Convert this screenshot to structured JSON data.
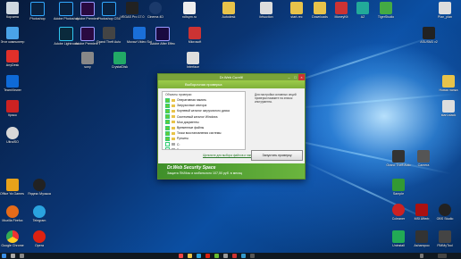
{
  "window": {
    "title": "Dr.Web CureIt!",
    "header": "Выборочная проверка",
    "tree_header": "Объекты проверки",
    "tree_items": [
      "Оперативная память",
      "Загрузочные сектора",
      "Корневой каталог загрузочного диска",
      "Системный каталог Windows",
      "Мои документы",
      "Временные файлы",
      "Точки восстановления системы",
      "Руткиты",
      "C:",
      "D:"
    ],
    "info_text": "Для настройки основных опций проверки нажмите на значок инструмента.",
    "scan_button": "Запустить проверку",
    "link_text": "Щелкните для выбора файлов и папок",
    "banner_title": "Dr.Web Security Space",
    "banner_sub": "Защита ПК/Мас и мобильного 107,50 руб. в месяц"
  },
  "desktop_icons": {
    "left": [
      "Корзина",
      "Этот компьютер",
      "AnyDesk",
      "TeamViewer",
      "Кряко",
      "UltraISO",
      "Office Ya Games 2013",
      "Яндекс Музыка",
      "Mozilla Firefox",
      "Telegram",
      "Google Chrome",
      "Opera"
    ],
    "top_row": [
      "Photoshop",
      "Adobe Photoshop",
      "Adobe Premiere",
      "Photoshop CS6",
      "VEGAS Pro 17.0",
      "Cinema 4D",
      "rollspm.ru",
      "Autodesk",
      "ibfsuction",
      "start-rec",
      "Downloads",
      "MoneyKit",
      "AZ",
      "TigerStudio",
      "Plan_plan"
    ],
    "middle": [
      "Adobe Lightroom",
      "Adobe Premiere Pro",
      "Grand Theft Auto San",
      "Movavi Video Suite",
      "Adobe After Effects 2020",
      "Microsoft",
      "sony",
      "CrystalDisk",
      "Interface"
    ],
    "right": [
      "Новая папка",
      "ASUSM3 v2",
      "start-stack",
      "Grand Theft Auto",
      "Camera",
      "Sample",
      "Ccleaner",
      "MSI Afterb",
      "OBS Studio",
      "Uninstall",
      "Ashampoo",
      "FlMMyTool"
    ]
  }
}
